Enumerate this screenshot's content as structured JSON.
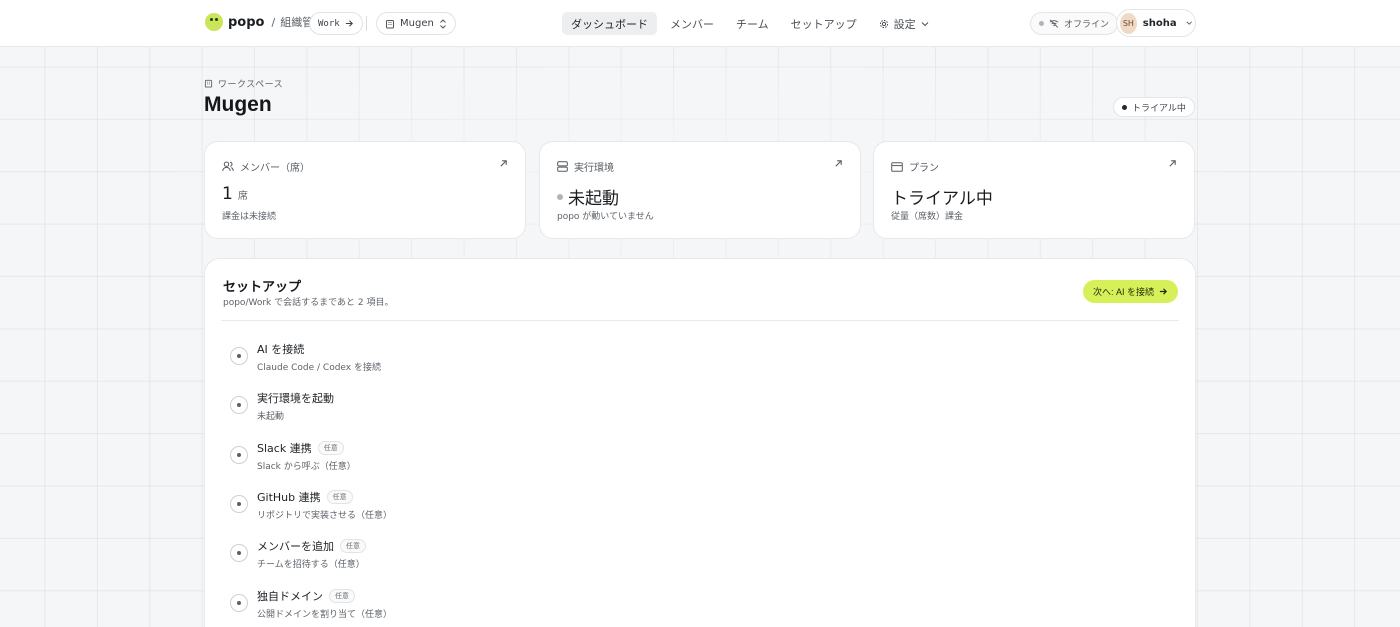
{
  "topbar": {
    "brand": "popo",
    "separator": "/",
    "org": "組織管理",
    "work_chip": "Work",
    "workspace_chip": "Mugen",
    "nav": [
      {
        "label": "ダッシュボード",
        "active": true
      },
      {
        "label": "メンバー",
        "active": false
      },
      {
        "label": "チーム",
        "active": false
      },
      {
        "label": "セットアップ",
        "active": false
      },
      {
        "label": "設定",
        "active": false
      }
    ],
    "status": "オフライン",
    "user": {
      "initials": "SH",
      "name": "shoha"
    }
  },
  "header": {
    "section_label": "ワークスペース",
    "title": "Mugen",
    "badge": "トライアル中"
  },
  "cards": [
    {
      "label": "メンバー（席）",
      "value": "1",
      "unit": "席",
      "sub": "課金は未接続",
      "icon": "users-icon"
    },
    {
      "label": "実行環境",
      "value": "未起動",
      "sub": "popo が動いていません",
      "icon": "server-icon"
    },
    {
      "label": "プラン",
      "value": "トライアル中",
      "sub": "従量（席数）課金",
      "icon": "credit-card-icon"
    }
  ],
  "setup": {
    "title": "セットアップ",
    "subtitle": "popo/Work で会話するまであと 2 項目。",
    "next_button": "次へ: AI を接続",
    "optional_tag": "任意",
    "steps": [
      {
        "title": "AI を接続",
        "desc": "Claude Code / Codex を接続",
        "optional": false
      },
      {
        "title": "実行環境を起動",
        "desc": "未起動",
        "optional": false
      },
      {
        "title": "Slack 連携",
        "desc": "Slack から呼ぶ（任意）",
        "optional": true
      },
      {
        "title": "GitHub 連携",
        "desc": "リポジトリで実装させる（任意）",
        "optional": true
      },
      {
        "title": "メンバーを追加",
        "desc": "チームを招待する（任意）",
        "optional": true
      },
      {
        "title": "独自ドメイン",
        "desc": "公開ドメインを割り当て（任意）",
        "optional": true
      }
    ]
  },
  "colors": {
    "accent": "#d6f05a",
    "logo": "#c9e55a",
    "background": "#f5f6f7"
  }
}
